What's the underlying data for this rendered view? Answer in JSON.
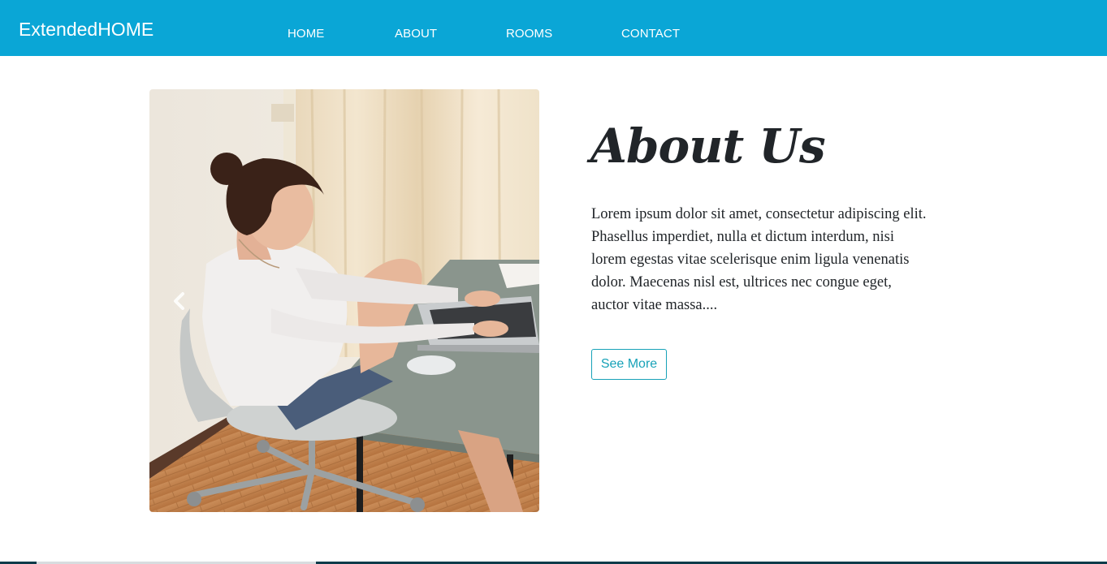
{
  "navbar": {
    "brand": "ExtendedHOME",
    "links": [
      {
        "label": "HOME"
      },
      {
        "label": "ABOUT"
      },
      {
        "label": "ROOMS"
      },
      {
        "label": "CONTACT"
      }
    ],
    "background_color": "#0aa6d6"
  },
  "carousel": {
    "prev_icon": "chevron-left-icon"
  },
  "about": {
    "title": "About Us",
    "body": "Lorem ipsum dolor sit amet, consectetur adipiscing elit. Phasellus imperdiet, nulla et dictum interdum, nisi lorem egestas vitae scelerisque enim ligula venenatis dolor. Maecenas nisl est, ultrices nec congue eget, auctor vitae massa....",
    "button_label": "See More",
    "accent_color": "#17a2b8"
  }
}
